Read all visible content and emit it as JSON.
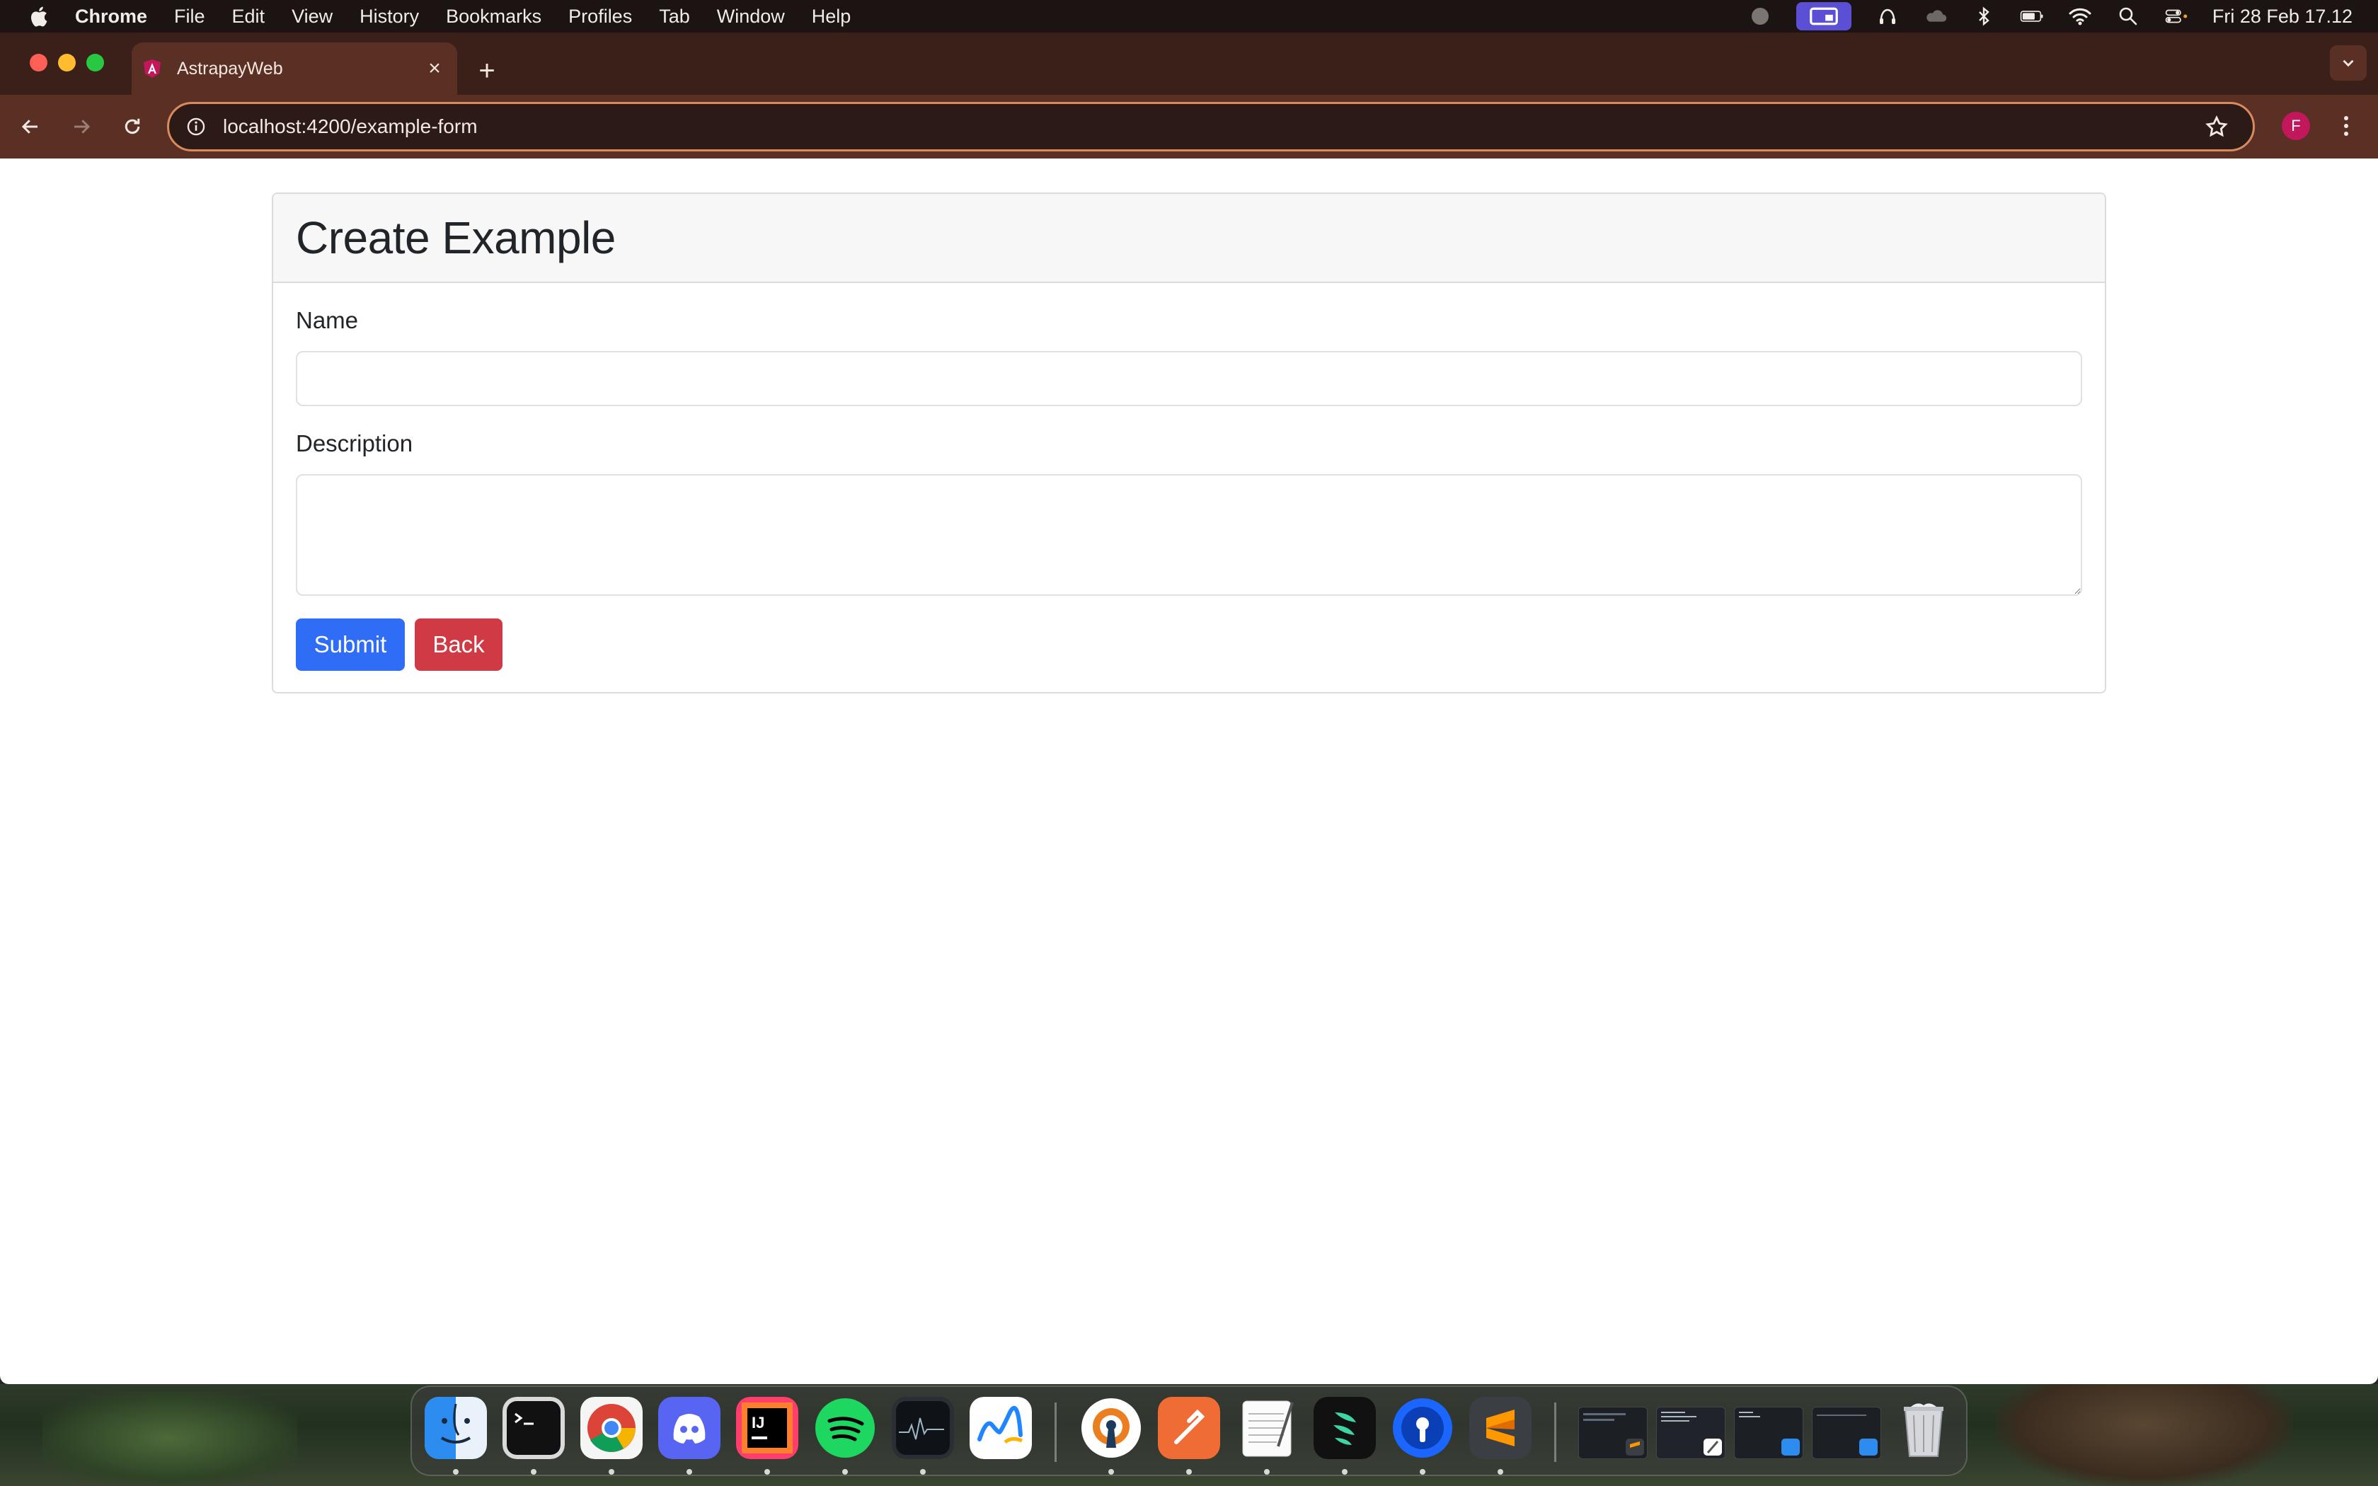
{
  "menubar": {
    "app_name": "Chrome",
    "items": [
      "File",
      "Edit",
      "View",
      "History",
      "Bookmarks",
      "Profiles",
      "Tab",
      "Window",
      "Help"
    ],
    "clock": "Fri 28 Feb  17.12"
  },
  "browser": {
    "tab_title": "AstrapayWeb",
    "url": "localhost:4200/example-form",
    "profile_initial": "F"
  },
  "form": {
    "title": "Create Example",
    "name_label": "Name",
    "name_value": "",
    "description_label": "Description",
    "description_value": "",
    "submit_label": "Submit",
    "back_label": "Back"
  },
  "colors": {
    "primary_button": "#2f6df6",
    "danger_button": "#d03a45",
    "omnibox_focus": "#d98a5e"
  },
  "dock": {
    "apps": [
      "finder-icon",
      "terminal-icon",
      "chrome-icon",
      "discord-icon",
      "intellij-icon",
      "spotify-icon",
      "activity-monitor-icon",
      "freeform-icon",
      "openvpn-icon",
      "postman-icon",
      "textedit-icon",
      "dock-app-icon",
      "1password-icon",
      "sublime-text-icon",
      "trash-icon"
    ]
  }
}
